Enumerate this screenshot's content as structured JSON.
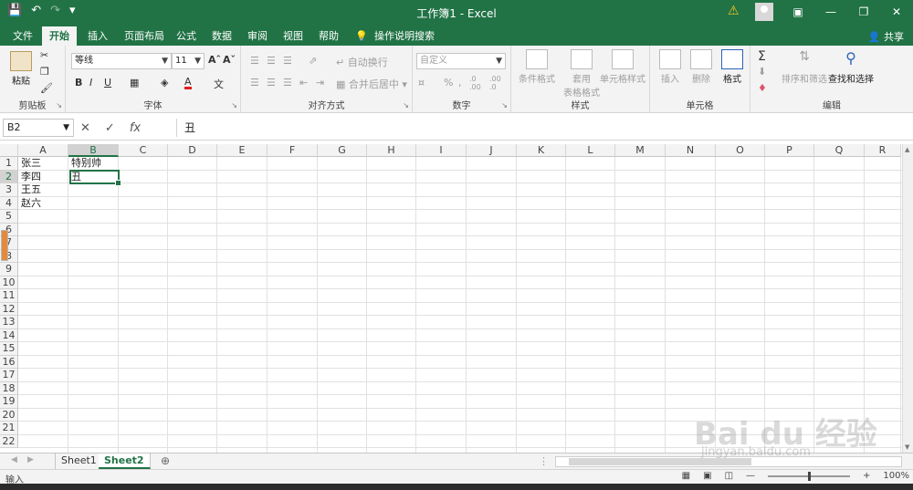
{
  "window": {
    "title": "工作簿1  -  Excel",
    "qat": [
      "save-icon",
      "undo-icon",
      "redo-icon",
      "customize-icon"
    ],
    "controls": [
      "ribbon-display-icon",
      "minimize-icon",
      "restore-icon",
      "close-icon"
    ]
  },
  "tabs": [
    "文件",
    "开始",
    "插入",
    "页面布局",
    "公式",
    "数据",
    "审阅",
    "视图",
    "帮助",
    "操作说明搜索"
  ],
  "share_label": "共享",
  "ribbon": {
    "clipboard": {
      "label": "剪贴板",
      "paste": "粘贴"
    },
    "font": {
      "label": "字体",
      "name": "等线",
      "size": "11"
    },
    "alignment": {
      "label": "对齐方式",
      "wrap": "自动换行",
      "merge": "合并后居中"
    },
    "number": {
      "label": "数字",
      "format": "自定义"
    },
    "styles": {
      "label": "样式",
      "conditional": "条件格式",
      "table": "套用",
      "table2": "表格格式",
      "cell_styles": "单元格样式"
    },
    "cells": {
      "label": "单元格",
      "insert": "插入",
      "delete": "删除",
      "format": "格式"
    },
    "editing": {
      "label": "编辑",
      "sort": "排序和筛选",
      "find": "查找和选择"
    }
  },
  "formula_bar": {
    "name_box": "B2",
    "value": "丑"
  },
  "columns": [
    "A",
    "B",
    "C",
    "D",
    "E",
    "F",
    "G",
    "H",
    "I",
    "J",
    "K",
    "L",
    "M",
    "N",
    "O",
    "P",
    "Q",
    "R"
  ],
  "rows": [
    "1",
    "2",
    "3",
    "4",
    "5",
    "6",
    "7",
    "8",
    "9",
    "10",
    "11",
    "12",
    "13",
    "14",
    "15",
    "16",
    "17",
    "18",
    "19",
    "20",
    "21",
    "22"
  ],
  "cells": {
    "A1": "张三",
    "A2": "李四",
    "A3": "王五",
    "A4": "赵六",
    "B1": "特别帅",
    "B2": "丑"
  },
  "sheets": [
    "Sheet1",
    "Sheet2"
  ],
  "active_sheet": "Sheet2",
  "status": {
    "mode": "输入",
    "zoom": "100%"
  },
  "watermark": {
    "main": "Bai du 经验",
    "sub": "jingyan.baidu.com"
  },
  "colors": {
    "accent": "#217346",
    "warning": "#f7c21a"
  }
}
